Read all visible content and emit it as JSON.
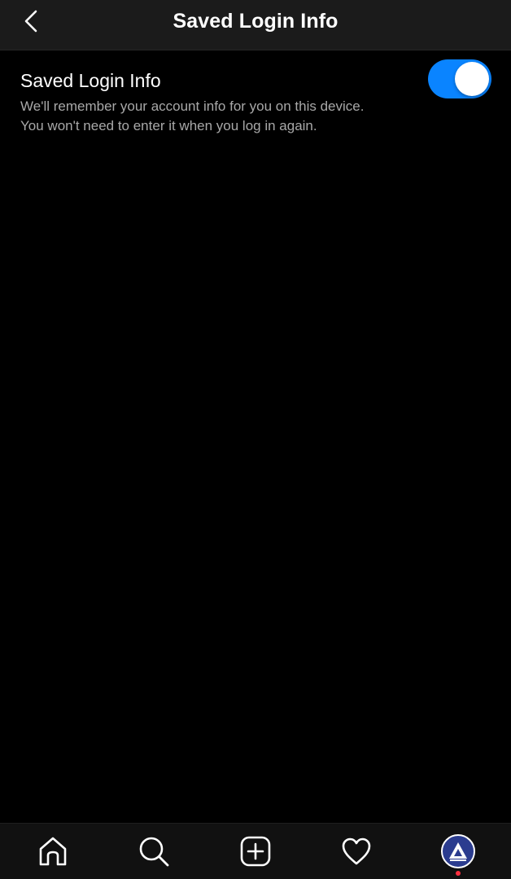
{
  "header": {
    "title": "Saved Login Info",
    "back_icon": "chevron-left-icon"
  },
  "setting": {
    "title": "Saved Login Info",
    "description_line1": "We'll remember your account info for you on this device.",
    "description_line2": "You won't need to enter it when you log in again.",
    "toggle_on": true
  },
  "tabbar": {
    "items": [
      {
        "icon": "home-icon"
      },
      {
        "icon": "search-icon"
      },
      {
        "icon": "create-post-icon"
      },
      {
        "icon": "heart-icon"
      },
      {
        "icon": "profile-avatar"
      }
    ]
  },
  "colors": {
    "background": "#000000",
    "header_background": "#1b1b1b",
    "toggle_on": "#0a84ff",
    "secondary_text": "#a8a8a8",
    "notification_dot": "#ff3040"
  }
}
